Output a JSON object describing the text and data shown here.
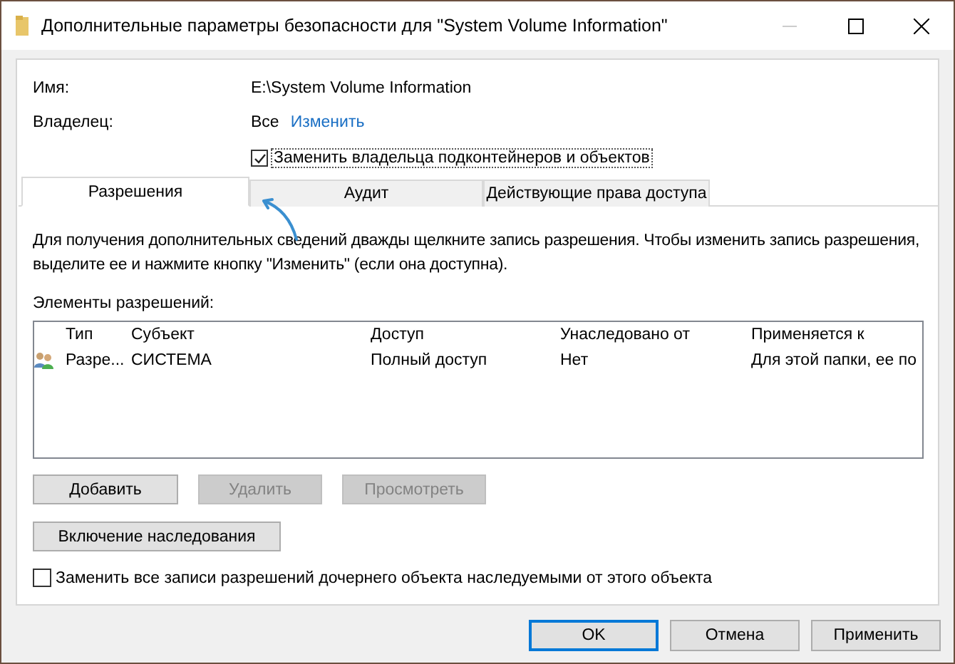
{
  "window": {
    "title": "Дополнительные параметры безопасности  для \"System Volume Information\""
  },
  "name": {
    "label": "Имя:",
    "value": "E:\\System Volume Information"
  },
  "owner": {
    "label": "Владелец:",
    "value": "Все",
    "change_link": "Изменить"
  },
  "replace_owner": {
    "label": "Заменить владельца подконтейнеров и объектов",
    "checked": true
  },
  "tabs": [
    {
      "label": "Разрешения",
      "selected": true
    },
    {
      "label": "Аудит",
      "selected": false
    },
    {
      "label": "Действующие права доступа",
      "selected": false
    }
  ],
  "description": "Для получения дополнительных сведений дважды щелкните запись разрешения. Чтобы изменить запись разрешения, выделите ее и нажмите кнопку \"Изменить\" (если она доступна).",
  "entries_label": "Элементы разрешений:",
  "table": {
    "columns": [
      "Тип",
      "Субъект",
      "Доступ",
      "Унаследовано от",
      "Применяется к"
    ],
    "rows": [
      {
        "cells": [
          "Разре...",
          "СИСТЕМА",
          "Полный доступ",
          "Нет",
          "Для этой папки, ее по"
        ],
        "selected": false
      }
    ]
  },
  "entry_buttons": [
    {
      "label": "Добавить",
      "disabled": false
    },
    {
      "label": "Удалить",
      "disabled": true
    },
    {
      "label": "Просмотреть",
      "disabled": true
    }
  ],
  "inheritance_button": {
    "label": "Включение наследования",
    "disabled": false
  },
  "replace_child": {
    "label": "Заменить все записи разрешений дочернего объекта наследуемыми от этого объекта",
    "checked": false
  },
  "dialog_buttons": [
    {
      "label": "OK",
      "kind": "default"
    },
    {
      "label": "Отмена",
      "kind": "normal"
    },
    {
      "label": "Применить",
      "kind": "normal"
    }
  ]
}
